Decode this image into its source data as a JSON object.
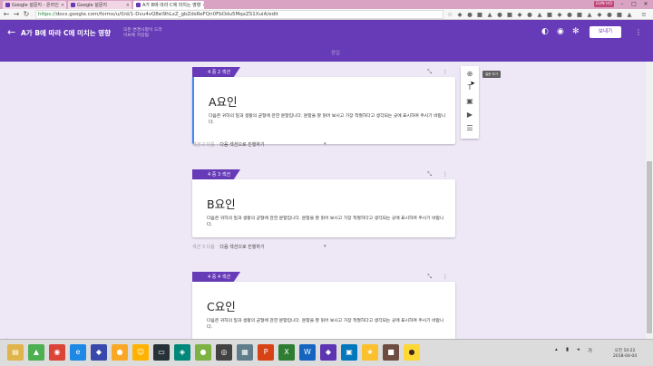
{
  "browser": {
    "tabs": [
      {
        "title": "Google 설문지 - 온라인"
      },
      {
        "title": "Google 설문지"
      },
      {
        "title": "A가 B에 따라 C에 미치는 영향"
      }
    ],
    "user": "EUN HO",
    "url_scheme": "https://",
    "url_rest": "docs.google.com/forms/u/0/d/1-Dvu4vQ8el9hLxZ_gbZdsReFQn0FbOdu5MqxZS1XuiA/edit"
  },
  "header": {
    "title": "A가 B에 따라 C에 미치는 영향",
    "save_hint": "모든 변경사항이 드라이브에 저장됨",
    "send_label": "보내기",
    "icons": [
      "palette-icon",
      "eye-icon",
      "gear-icon"
    ],
    "tabs": {
      "questions": "질문",
      "responses": "응답"
    }
  },
  "toolbar": {
    "tooltip": "질문 추가",
    "items": [
      "add-question",
      "add-title",
      "add-image",
      "add-video",
      "add-section"
    ]
  },
  "sections": [
    {
      "label": "4 중 2 섹션",
      "title": "A요인",
      "description": "다음은 귀하의 일과 생활의 균형에 관한 문항입니다. 문항을 잘 읽어 보시고 가장 적절하다고 생각되는 곳에 표시하여 주시기 바랍니다.",
      "after_label": "섹션 2 다음",
      "after_value": "다음 섹션으로 진행하기"
    },
    {
      "label": "4 중 3 섹션",
      "title": "B요인",
      "description": "다음은 귀하의 일과 생활의 균형에 관한 문항입니다. 문항을 잘 읽어 보시고 가장 적절하다고 생각되는 곳에 표시하여 주시기 바랍니다.",
      "after_label": "섹션 3 다음",
      "after_value": "다음 섹션으로 진행하기"
    },
    {
      "label": "4 중 4 섹션",
      "title": "C요인",
      "description": "다음은 귀하의 일과 생활의 균형에 관한 문항입니다. 문항을 잘 읽어 보시고 가장 적절하다고 생각되는 곳에 표시하여 주시기 바랍니다."
    }
  ],
  "taskbar": {
    "time": "오전 10:22",
    "date": "2018-04-04",
    "language": "가"
  },
  "colors": {
    "accent": "#673ab7",
    "background": "#ede7f6",
    "focus": "#4285f4"
  }
}
